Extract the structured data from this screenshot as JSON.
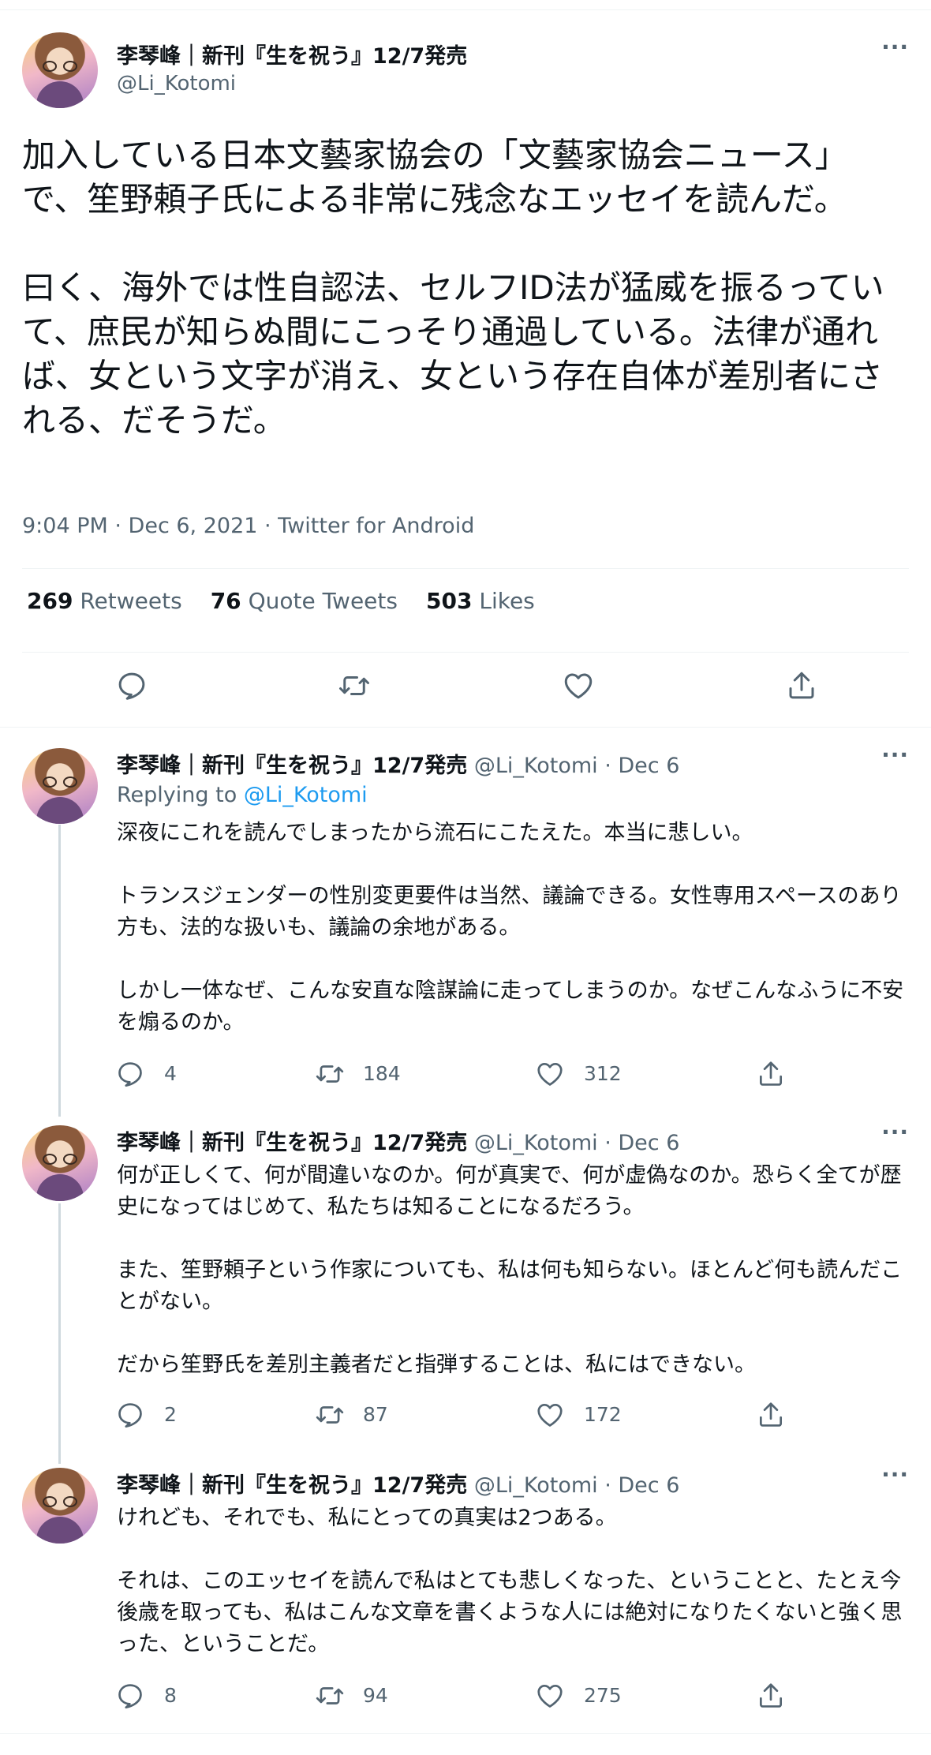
{
  "main_tweet": {
    "author_name": "李琴峰｜新刊『生を祝う』12/7発売",
    "handle": "@Li_Kotomi",
    "text": "加入している日本文藝家協会の「文藝家協会ニュース」で、笙野頼子氏による非常に残念なエッセイを読んだ。\n\n曰く、海外では性自認法、セルフID法が猛威を振るっていて、庶民が知らぬ間にこっそり通過している。法律が通れば、女という文字が消え、女という存在自体が差別者にされる、だそうだ。",
    "meta": "9:04 PM · Dec 6, 2021 · Twitter for Android",
    "retweets_count": "269",
    "retweets_label": "Retweets",
    "quotes_count": "76",
    "quotes_label": "Quote Tweets",
    "likes_count": "503",
    "likes_label": "Likes",
    "more": "···"
  },
  "replies": [
    {
      "author_name": "李琴峰｜新刊『生を祝う』12/7発売",
      "handle_date": " @Li_Kotomi · Dec 6",
      "replying_prefix": "Replying to ",
      "replying_to": "@Li_Kotomi",
      "text": "深夜にこれを読んでしまったから流石にこたえた。本当に悲しい。\n\nトランスジェンダーの性別変更要件は当然、議論できる。女性専用スペースのあり方も、法的な扱いも、議論の余地がある。\n\nしかし一体なぜ、こんな安直な陰謀論に走ってしまうのか。なぜこんなふうに不安を煽るのか。",
      "replies": "4",
      "retweets": "184",
      "likes": "312"
    },
    {
      "author_name": "李琴峰｜新刊『生を祝う』12/7発売",
      "handle_date": " @Li_Kotomi · Dec 6",
      "text": "何が正しくて、何が間違いなのか。何が真実で、何が虚偽なのか。恐らく全てが歴史になってはじめて、私たちは知ることになるだろう。\n\nまた、笙野頼子という作家についても、私は何も知らない。ほとんど何も読んだことがない。\n\nだから笙野氏を差別主義者だと指弾することは、私にはできない。",
      "replies": "2",
      "retweets": "87",
      "likes": "172"
    },
    {
      "author_name": "李琴峰｜新刊『生を祝う』12/7発売",
      "handle_date": " @Li_Kotomi · Dec 6",
      "text": "けれども、それでも、私にとっての真実は2つある。\n\nそれは、このエッセイを読んで私はとても悲しくなった、ということと、たとえ今後歳を取っても、私はこんな文章を書くような人には絶対になりたくないと強く思った、ということだ。",
      "replies": "8",
      "retweets": "94",
      "likes": "275"
    }
  ],
  "colors": {
    "text": "#0f1419",
    "secondary": "#536471",
    "link": "#1d9bf0",
    "border": "#eff3f4",
    "thread_line": "#cfd9de"
  },
  "icons": [
    "reply-icon",
    "retweet-icon",
    "like-icon",
    "share-icon",
    "more-icon"
  ]
}
